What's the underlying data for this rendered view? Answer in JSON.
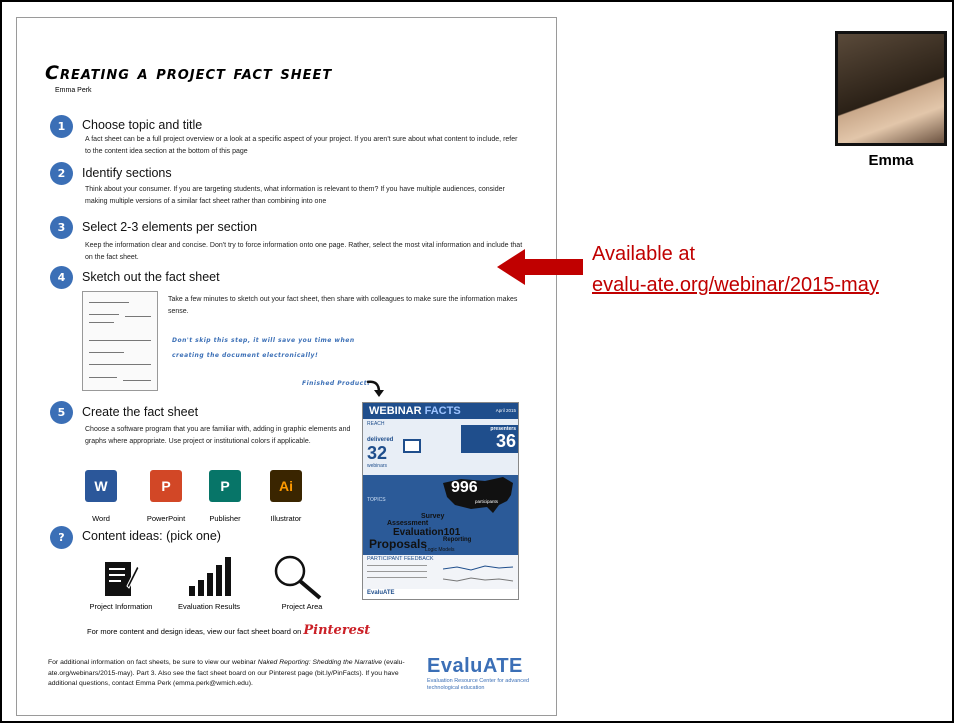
{
  "slide": {
    "photo_name": "Emma",
    "available_label": "Available at",
    "available_url": "evalu-ate.org/webinar/2015-may",
    "accent_color": "#c00000"
  },
  "doc": {
    "title": "Creating a project fact sheet",
    "author": "Emma Perk",
    "steps": [
      {
        "num": "1",
        "title": "Choose topic and title",
        "text": "A fact sheet can be a full project overview or a look at a specific aspect of your project. If you aren't sure about what content to include, refer to the content idea section at the bottom of this page"
      },
      {
        "num": "2",
        "title": "Identify sections",
        "text": "Think about your consumer. If you are targeting students, what information is relevant to them? If you have multiple audiences, consider making multiple versions of a similar fact sheet rather than combining into one"
      },
      {
        "num": "3",
        "title": "Select 2-3 elements per section",
        "text": "Keep the information clear and concise. Don't try to force information onto one page. Rather, select the most vital information and include that on the fact sheet."
      },
      {
        "num": "4",
        "title": "Sketch out the fact sheet",
        "text": "Take a few minutes to sketch out your fact sheet, then share with colleagues to make sure the information makes sense."
      },
      {
        "num": "5",
        "title": "Create the fact sheet",
        "text": "Choose a software program that you are familiar with, adding in graphic elements and graphs where appropriate. Use project or institutional colors if applicable."
      },
      {
        "num": "?",
        "title": "Content ideas: (pick one)",
        "text": ""
      }
    ],
    "sketch_note_1": "Don't skip this step, it will save you time when",
    "sketch_note_2": "creating the document electronically!",
    "finished_label": "Finished Product!",
    "apps": [
      {
        "label": "Word",
        "glyph": "W",
        "color": "#2b579a"
      },
      {
        "label": "PowerPoint",
        "glyph": "P",
        "color": "#d24726"
      },
      {
        "label": "Publisher",
        "glyph": "P",
        "color": "#077568"
      },
      {
        "label": "Illustrator",
        "glyph": "Ai",
        "color": "#3a2500"
      }
    ],
    "content_ideas": [
      "Project Information",
      "Evaluation Results",
      "Project Area"
    ],
    "pinterest_line": "For more content and design ideas, view our fact sheet board on",
    "pinterest_brand": "Pinterest",
    "footer_1": "For additional information on fact sheets, be sure to view our webinar",
    "footer_webinar": "Naked Reporting: Shedding the Narrative",
    "footer_2": "(evalu-ate.org/webinars/2015-may). Part 3. Also see the fact sheet board on our Pinterest page (bit.ly/PinFacts). If you have additional questions, contact Emma Perk (emma.perk@wmich.edu).",
    "logo": "EvaluATE",
    "logo_tag": "Evaluation Resource Center for advanced technological education"
  },
  "poster": {
    "title_1": "WEBINAR",
    "title_2": "FACTS",
    "date": "April 2015",
    "reach": "REACH",
    "delivered": "delivered",
    "webinars_num": "32",
    "webinars": "webinars",
    "presenters": "presenters",
    "presenters_num": "36",
    "participants_num": "996",
    "participants": "participants",
    "topics": "TOPICS",
    "words": [
      "Survey",
      "Assessment",
      "Evaluation101",
      "Proposals",
      "Reporting",
      "Logic Models"
    ],
    "feedback": "PARTICIPANT FEEDBACK",
    "foot": "EvaluATE"
  }
}
